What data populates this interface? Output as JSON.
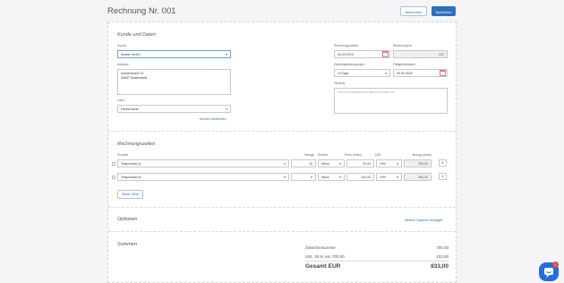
{
  "header": {
    "title": "Rechnung Nr. 001",
    "cancel_label": "Abbrechen",
    "save_label": "Speichern"
  },
  "customer_section": {
    "heading": "Kunde und Daten",
    "customer_label": "Kunde",
    "customer_value": "Muster GmbH",
    "address_label": "Adresse",
    "address_line1": "Musterstraße 12",
    "address_line2": "34567 Musterstadt",
    "country_label": "Land",
    "country_value": "Deutschland",
    "edit_customer_link": "Kunden bearbeiten",
    "invoice_date_label": "Rechnungsdatum",
    "invoice_date_value": "26.03.2018",
    "invoice_no_label": "Rechnungsnr.",
    "invoice_no_value": "001",
    "payment_terms_label": "Zahlungsbedingungen",
    "payment_terms_value": "10 Tage",
    "due_date_label": "Fälligkeitsdatum",
    "due_date_value": "05.04.2018",
    "notes_label": "Hinweis",
    "notes_placeholder": "Gib eine Nachricht an deinen Kunden ein"
  },
  "lines_section": {
    "heading": "Rechnungszeilen",
    "columns": {
      "product": "Produkt",
      "quantity": "Menge",
      "unit": "Einheit",
      "price": "Preis (netto)",
      "vat": "USt.",
      "amount": "Betrag (netto)"
    },
    "rows": [
      {
        "product": "Testprodukt #1",
        "quantity": "10",
        "unit": "Stück",
        "price": "20,00",
        "vat": "19%",
        "amount": "200,00"
      },
      {
        "product": "Testprodukt #2",
        "quantity": "5",
        "unit": "Stück",
        "price": "100,00",
        "vat": "19%",
        "amount": "500,00"
      }
    ],
    "new_line_label": "Neue Zeile"
  },
  "options_section": {
    "heading": "Optionen",
    "more_options_link": "Weitere Optionen anzeigen"
  },
  "totals_section": {
    "heading": "Summen",
    "subtotal_label": "Zwischensumme",
    "subtotal_value": "700,00",
    "vat_label": "USt. 19 % von 700,00",
    "vat_value": "133,00",
    "total_label": "Gesamt EUR",
    "total_value": "833,00"
  },
  "chat": {
    "badge_count": "1"
  },
  "colors": {
    "primary": "#2d6fba",
    "link": "#2f6fb4",
    "chat": "#1f6fe0",
    "badge": "#e74c3c"
  }
}
